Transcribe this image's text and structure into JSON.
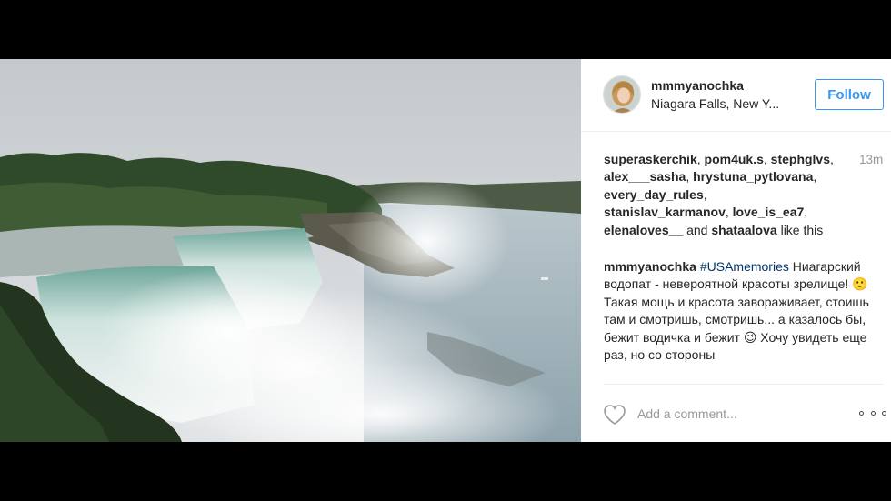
{
  "post": {
    "username": "mmmyanochka",
    "location": "Niagara Falls, New Y...",
    "follow_label": "Follow",
    "time_ago": "13m",
    "likes": {
      "users": [
        "superaskerchik",
        "pom4uk.s",
        "stephglvs",
        "alex___sasha",
        "hrystuna_pytlovana",
        "every_day_rules",
        "stanislav_karmanov",
        "love_is_ea7",
        "elenaloves__",
        "shataalova"
      ],
      "and_word": "and",
      "suffix": "like this"
    },
    "caption": {
      "username": "mmmyanochka",
      "hashtag": "#USAmemories",
      "text": "Ниагарский водопат - невероятной красоты зрелище! 🙂 Такая мощь и красота завораживает, стоишь там и смотришь, смотришь... а казалось бы, бежит водичка и бежит 😉 Хочу увидеть еще раз, но со стороны"
    },
    "comment_placeholder": "Add a comment..."
  },
  "icons": {
    "heart": "heart-outline-icon",
    "more": "more-options-icon"
  },
  "colors": {
    "follow_blue": "#3897f0",
    "hashtag": "#003569",
    "muted": "#999999"
  }
}
